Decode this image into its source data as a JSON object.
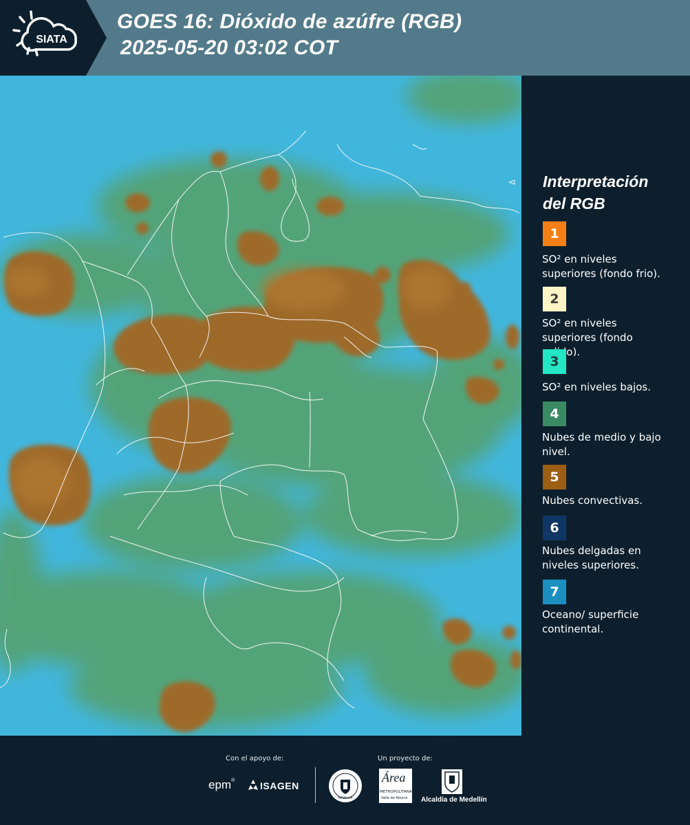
{
  "header": {
    "logo_text": "SIATA",
    "title_line1": "GOES 16: Dióxido de azúfre (RGB)",
    "title_line2": "2025-05-20 03:02 COT"
  },
  "legend": {
    "title_line1": "Interpretación",
    "title_line2": "del RGB",
    "items": [
      {
        "num": "1",
        "color": "#f57f14",
        "num_color": "#ffffff",
        "text": "SO² en niveles superiores (fondo frio)."
      },
      {
        "num": "2",
        "color": "#fdf5c4",
        "num_color": "#3a3a3a",
        "text": "SO² en niveles superiores (fondo calido)."
      },
      {
        "num": "3",
        "color": "#23e6c4",
        "num_color": "#1d3a3a",
        "text": "SO² en niveles bajos."
      },
      {
        "num": "4",
        "color": "#3a8a63",
        "num_color": "#ffffff",
        "text": "Nubes de medio y bajo nivel."
      },
      {
        "num": "5",
        "color": "#9c5e12",
        "num_color": "#ffffff",
        "text": "Nubes convectivas."
      },
      {
        "num": "6",
        "color": "#0f3664",
        "num_color": "#ffffff",
        "text": "Nubes delgadas en niveles superiores."
      },
      {
        "num": "7",
        "color": "#1b8fc0",
        "num_color": "#ffffff",
        "text": "Oceano/ superficie continental."
      }
    ]
  },
  "footer": {
    "support_caption": "Con el apoyo de:",
    "project_caption": "Un proyecto de:",
    "epm": "epm",
    "isagen": "ISAGEN",
    "area_name": "Área",
    "area_line1": "METROPOLITANA",
    "area_line2": "Valle de Aburrá",
    "alcaldia": "Alcaldía de Medellín",
    "seal_text": "MEDELLÍN"
  },
  "colors": {
    "header_bg": "#527a8a",
    "panel_bg": "#0d1f2d",
    "ocean": "#3fb7e0",
    "land_green": "#5e9e55",
    "convective": "#9c6a2a"
  }
}
